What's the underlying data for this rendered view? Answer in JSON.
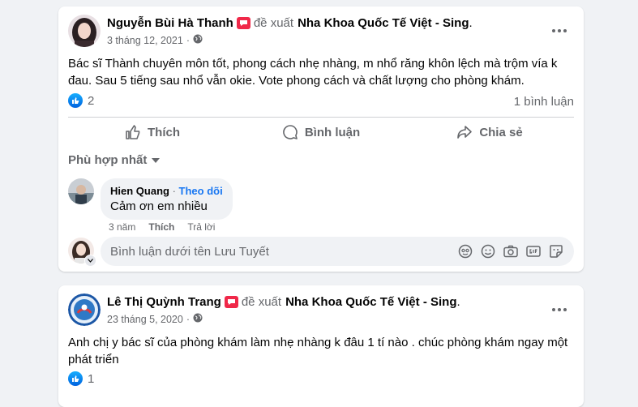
{
  "posts": [
    {
      "author": "Nguyễn Bùi Hà Thanh",
      "recommends_verb": "đề xuất",
      "page_name": "Nha Khoa Quốc Tế Việt - Sing",
      "trail": ".",
      "date": "3 tháng 12, 2021",
      "meta_sep": "·",
      "text": "Bác sĩ Thành chuyên môn tốt, phong cách nhẹ nhàng, m nhổ răng khôn lệch mà trộm vía k đau. Sau 5 tiếng sau nhổ vẫn okie. Vote phong cách và chất lượng cho phòng khám.",
      "like_count": "2",
      "comment_count": "1 bình luận",
      "actions": {
        "like": "Thích",
        "comment": "Bình luận",
        "share": "Chia sẻ"
      },
      "sort_label": "Phù hợp nhất",
      "comment": {
        "commenter": "Hien Quang",
        "follow_sep": "·",
        "follow_label": "Theo dõi",
        "text": "Cảm ơn em nhiều",
        "age": "3 năm",
        "like_label": "Thích",
        "reply_label": "Trả lời"
      },
      "comment_input_placeholder": "Bình luận dưới tên Lưu Tuyết"
    },
    {
      "author": "Lê Thị Quỳnh Trang",
      "recommends_verb": "đề xuất",
      "page_name": "Nha Khoa Quốc Tế Việt - Sing",
      "trail": ".",
      "date": "23 tháng 5, 2020",
      "meta_sep": "·",
      "text": "Anh chị y bác sĩ của phòng khám làm nhẹ nhàng k đâu 1 tí nào . chúc phòng khám ngay  một phát triển",
      "like_count": "1"
    }
  ],
  "colors": {
    "background": "#f0f2f5",
    "card": "#ffffff",
    "link_blue": "#1877f2",
    "secondary_text": "#65676b",
    "recommend_badge": "#f02849"
  }
}
